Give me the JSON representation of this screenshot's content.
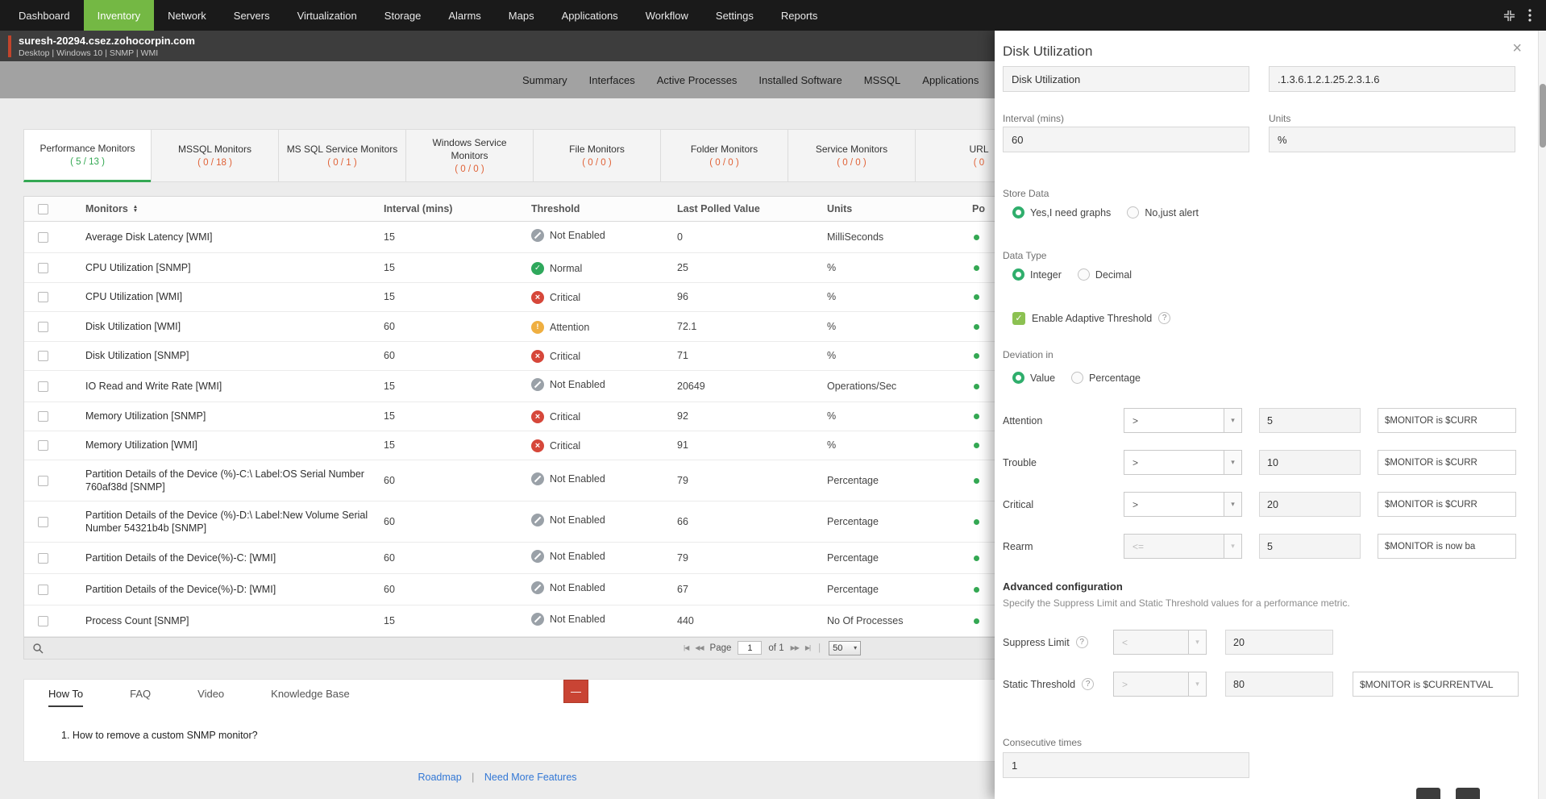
{
  "icons": {
    "check": "✓",
    "cross": "×",
    "exclaim": "!",
    "caret": "▾",
    "minus": "—",
    "close": "×",
    "sort_asc": "▲",
    "sort_desc": "▼"
  },
  "nav": {
    "items": [
      {
        "label": "Dashboard",
        "active": false
      },
      {
        "label": "Inventory",
        "active": true
      },
      {
        "label": "Network",
        "active": false
      },
      {
        "label": "Servers",
        "active": false
      },
      {
        "label": "Virtualization",
        "active": false
      },
      {
        "label": "Storage",
        "active": false
      },
      {
        "label": "Alarms",
        "active": false
      },
      {
        "label": "Maps",
        "active": false
      },
      {
        "label": "Applications",
        "active": false
      },
      {
        "label": "Workflow",
        "active": false
      },
      {
        "label": "Settings",
        "active": false
      },
      {
        "label": "Reports",
        "active": false
      }
    ]
  },
  "device": {
    "name": "suresh-20294.csez.zohocorpin.com",
    "meta": "Desktop | Windows 10 | SNMP | WMI"
  },
  "page_tabs": [
    "Summary",
    "Interfaces",
    "Active Processes",
    "Installed Software",
    "MSSQL",
    "Applications"
  ],
  "monitor_tabs": [
    {
      "label": "Performance Monitors",
      "count": "( 5 / 13 )",
      "active": true
    },
    {
      "label": "MSSQL Monitors",
      "count": "( 0 / 18 )",
      "active": false
    },
    {
      "label": "MS SQL Service Monitors",
      "count": "( 0 / 1 )",
      "active": false
    },
    {
      "label": "Windows Service Monitors",
      "count": "( 0 / 0 )",
      "active": false
    },
    {
      "label": "File Monitors",
      "count": "( 0 / 0 )",
      "active": false
    },
    {
      "label": "Folder Monitors",
      "count": "( 0 / 0 )",
      "active": false
    },
    {
      "label": "Service Monitors",
      "count": "( 0 / 0 )",
      "active": false
    },
    {
      "label": "URL",
      "count": "( 0",
      "active": false
    }
  ],
  "table": {
    "header": {
      "monitors": "Monitors",
      "interval": "Interval (mins)",
      "threshold": "Threshold",
      "last_polled": "Last Polled Value",
      "units": "Units",
      "actions": "Po"
    },
    "rows": [
      {
        "name": "Average Disk Latency [WMI]",
        "interval": "15",
        "threshold_status": "disabled",
        "threshold_label": "Not Enabled",
        "value": "0",
        "units": "MilliSeconds"
      },
      {
        "name": "CPU Utilization [SNMP]",
        "interval": "15",
        "threshold_status": "normal",
        "threshold_label": "Normal",
        "value": "25",
        "units": "%"
      },
      {
        "name": "CPU Utilization [WMI]",
        "interval": "15",
        "threshold_status": "critical",
        "threshold_label": "Critical",
        "value": "96",
        "units": "%"
      },
      {
        "name": "Disk Utilization [WMI]",
        "interval": "60",
        "threshold_status": "attention",
        "threshold_label": "Attention",
        "value": "72.1",
        "units": "%"
      },
      {
        "name": "Disk Utilization [SNMP]",
        "interval": "60",
        "threshold_status": "critical",
        "threshold_label": "Critical",
        "value": "71",
        "units": "%"
      },
      {
        "name": "IO Read and Write Rate [WMI]",
        "interval": "15",
        "threshold_status": "disabled",
        "threshold_label": "Not Enabled",
        "value": "20649",
        "units": "Operations/Sec"
      },
      {
        "name": "Memory Utilization [SNMP]",
        "interval": "15",
        "threshold_status": "critical",
        "threshold_label": "Critical",
        "value": "92",
        "units": "%"
      },
      {
        "name": "Memory Utilization [WMI]",
        "interval": "15",
        "threshold_status": "critical",
        "threshold_label": "Critical",
        "value": "91",
        "units": "%"
      },
      {
        "name": "Partition Details of the Device (%)-C:\\ Label:OS Serial Number 760af38d [SNMP]",
        "interval": "60",
        "threshold_status": "disabled",
        "threshold_label": "Not Enabled",
        "value": "79",
        "units": "Percentage"
      },
      {
        "name": "Partition Details of the Device (%)-D:\\ Label:New Volume Serial Number 54321b4b [SNMP]",
        "interval": "60",
        "threshold_status": "disabled",
        "threshold_label": "Not Enabled",
        "value": "66",
        "units": "Percentage"
      },
      {
        "name": "Partition Details of the Device(%)-C: [WMI]",
        "interval": "60",
        "threshold_status": "disabled",
        "threshold_label": "Not Enabled",
        "value": "79",
        "units": "Percentage"
      },
      {
        "name": "Partition Details of the Device(%)-D: [WMI]",
        "interval": "60",
        "threshold_status": "disabled",
        "threshold_label": "Not Enabled",
        "value": "67",
        "units": "Percentage"
      },
      {
        "name": "Process Count [SNMP]",
        "interval": "15",
        "threshold_status": "disabled",
        "threshold_label": "Not Enabled",
        "value": "440",
        "units": "No Of Processes"
      }
    ]
  },
  "pagination": {
    "page_label": "Page",
    "page_value": "1",
    "of_label": "of 1",
    "page_size": "50",
    "sep": "|",
    "icons": {
      "first": "|◀",
      "prev": "◀◀",
      "next": "▶▶",
      "last": "▶|"
    }
  },
  "help": {
    "tabs": [
      {
        "label": "How To",
        "active": true
      },
      {
        "label": "FAQ",
        "active": false
      },
      {
        "label": "Video",
        "active": false
      },
      {
        "label": "Knowledge Base",
        "active": false
      }
    ],
    "content": "1. How to remove a custom SNMP monitor?"
  },
  "footer": {
    "links": [
      "Roadmap",
      "Need More Features"
    ],
    "sep": "|"
  },
  "panel": {
    "title": "Disk Utilization",
    "fields": {
      "name_value": "Disk Utilization",
      "oid_value": ".1.3.6.1.2.1.25.2.3.1.6",
      "interval_label": "Interval (mins)",
      "interval_value": "60",
      "units_label": "Units",
      "units_value": "%"
    },
    "store_data": {
      "label": "Store Data",
      "options": [
        {
          "label": "Yes,I need graphs",
          "selected": true
        },
        {
          "label": "No,just alert",
          "selected": false
        }
      ]
    },
    "data_type": {
      "label": "Data Type",
      "options": [
        {
          "label": "Integer",
          "selected": true
        },
        {
          "label": "Decimal",
          "selected": false
        }
      ]
    },
    "adaptive": {
      "label": "Enable Adaptive Threshold",
      "checked": true,
      "help_icon": "?"
    },
    "deviation": {
      "label": "Deviation in",
      "options": [
        {
          "label": "Value",
          "selected": true
        },
        {
          "label": "Percentage",
          "selected": false
        }
      ]
    },
    "thresholds": [
      {
        "label": "Attention",
        "operator": ">",
        "value": "5",
        "message": "$MONITOR is $CURR",
        "disabled": false
      },
      {
        "label": "Trouble",
        "operator": ">",
        "value": "10",
        "message": "$MONITOR is $CURR",
        "disabled": false
      },
      {
        "label": "Critical",
        "operator": ">",
        "value": "20",
        "message": "$MONITOR is $CURR",
        "disabled": false
      },
      {
        "label": "Rearm",
        "operator": "<=",
        "value": "5",
        "message": "$MONITOR is now ba",
        "disabled": true
      }
    ],
    "advanced": {
      "title": "Advanced configuration",
      "subtitle": "Specify the Suppress Limit and Static Threshold values for a performance metric.",
      "rows": [
        {
          "label": "Suppress Limit",
          "help_icon": "?",
          "operator": "<",
          "value": "20",
          "message": ""
        },
        {
          "label": "Static Threshold",
          "help_icon": "?",
          "operator": ">",
          "value": "80",
          "message": "$MONITOR is $CURRENTVAL"
        }
      ]
    },
    "consecutive": {
      "label": "Consecutive times",
      "value": "1"
    }
  }
}
